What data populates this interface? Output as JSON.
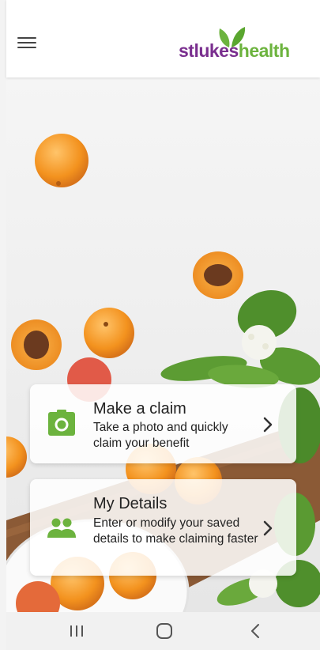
{
  "header": {
    "menu_label": "menu",
    "logo": {
      "part1": "st",
      "part2": "lukes",
      "part3": "health",
      "alt": "stlukeshealth"
    }
  },
  "cards": [
    {
      "title": "Make a claim",
      "description": "Take a photo and quickly claim your benefit",
      "icon": "camera-icon"
    },
    {
      "title": "My Details",
      "description": "Enter or modify your saved details to make claiming faster",
      "icon": "people-icon"
    }
  ],
  "nav": {
    "recent": "recent-apps-icon",
    "home": "home-icon",
    "back": "back-icon"
  },
  "colors": {
    "brand_purple": "#7a2f8f",
    "brand_green": "#6cb33e",
    "icon_green": "#6cb33e"
  }
}
